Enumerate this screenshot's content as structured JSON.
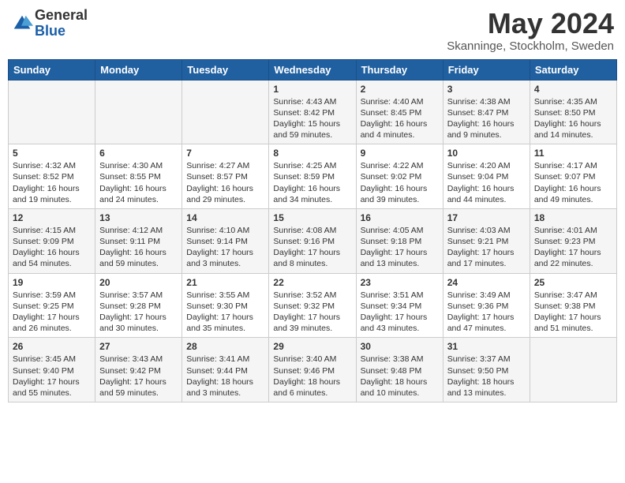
{
  "logo": {
    "general": "General",
    "blue": "Blue"
  },
  "title": "May 2024",
  "location": "Skanninge, Stockholm, Sweden",
  "weekdays": [
    "Sunday",
    "Monday",
    "Tuesday",
    "Wednesday",
    "Thursday",
    "Friday",
    "Saturday"
  ],
  "weeks": [
    [
      {
        "day": "",
        "info": ""
      },
      {
        "day": "",
        "info": ""
      },
      {
        "day": "",
        "info": ""
      },
      {
        "day": "1",
        "info": "Sunrise: 4:43 AM\nSunset: 8:42 PM\nDaylight: 15 hours\nand 59 minutes."
      },
      {
        "day": "2",
        "info": "Sunrise: 4:40 AM\nSunset: 8:45 PM\nDaylight: 16 hours\nand 4 minutes."
      },
      {
        "day": "3",
        "info": "Sunrise: 4:38 AM\nSunset: 8:47 PM\nDaylight: 16 hours\nand 9 minutes."
      },
      {
        "day": "4",
        "info": "Sunrise: 4:35 AM\nSunset: 8:50 PM\nDaylight: 16 hours\nand 14 minutes."
      }
    ],
    [
      {
        "day": "5",
        "info": "Sunrise: 4:32 AM\nSunset: 8:52 PM\nDaylight: 16 hours\nand 19 minutes."
      },
      {
        "day": "6",
        "info": "Sunrise: 4:30 AM\nSunset: 8:55 PM\nDaylight: 16 hours\nand 24 minutes."
      },
      {
        "day": "7",
        "info": "Sunrise: 4:27 AM\nSunset: 8:57 PM\nDaylight: 16 hours\nand 29 minutes."
      },
      {
        "day": "8",
        "info": "Sunrise: 4:25 AM\nSunset: 8:59 PM\nDaylight: 16 hours\nand 34 minutes."
      },
      {
        "day": "9",
        "info": "Sunrise: 4:22 AM\nSunset: 9:02 PM\nDaylight: 16 hours\nand 39 minutes."
      },
      {
        "day": "10",
        "info": "Sunrise: 4:20 AM\nSunset: 9:04 PM\nDaylight: 16 hours\nand 44 minutes."
      },
      {
        "day": "11",
        "info": "Sunrise: 4:17 AM\nSunset: 9:07 PM\nDaylight: 16 hours\nand 49 minutes."
      }
    ],
    [
      {
        "day": "12",
        "info": "Sunrise: 4:15 AM\nSunset: 9:09 PM\nDaylight: 16 hours\nand 54 minutes."
      },
      {
        "day": "13",
        "info": "Sunrise: 4:12 AM\nSunset: 9:11 PM\nDaylight: 16 hours\nand 59 minutes."
      },
      {
        "day": "14",
        "info": "Sunrise: 4:10 AM\nSunset: 9:14 PM\nDaylight: 17 hours\nand 3 minutes."
      },
      {
        "day": "15",
        "info": "Sunrise: 4:08 AM\nSunset: 9:16 PM\nDaylight: 17 hours\nand 8 minutes."
      },
      {
        "day": "16",
        "info": "Sunrise: 4:05 AM\nSunset: 9:18 PM\nDaylight: 17 hours\nand 13 minutes."
      },
      {
        "day": "17",
        "info": "Sunrise: 4:03 AM\nSunset: 9:21 PM\nDaylight: 17 hours\nand 17 minutes."
      },
      {
        "day": "18",
        "info": "Sunrise: 4:01 AM\nSunset: 9:23 PM\nDaylight: 17 hours\nand 22 minutes."
      }
    ],
    [
      {
        "day": "19",
        "info": "Sunrise: 3:59 AM\nSunset: 9:25 PM\nDaylight: 17 hours\nand 26 minutes."
      },
      {
        "day": "20",
        "info": "Sunrise: 3:57 AM\nSunset: 9:28 PM\nDaylight: 17 hours\nand 30 minutes."
      },
      {
        "day": "21",
        "info": "Sunrise: 3:55 AM\nSunset: 9:30 PM\nDaylight: 17 hours\nand 35 minutes."
      },
      {
        "day": "22",
        "info": "Sunrise: 3:52 AM\nSunset: 9:32 PM\nDaylight: 17 hours\nand 39 minutes."
      },
      {
        "day": "23",
        "info": "Sunrise: 3:51 AM\nSunset: 9:34 PM\nDaylight: 17 hours\nand 43 minutes."
      },
      {
        "day": "24",
        "info": "Sunrise: 3:49 AM\nSunset: 9:36 PM\nDaylight: 17 hours\nand 47 minutes."
      },
      {
        "day": "25",
        "info": "Sunrise: 3:47 AM\nSunset: 9:38 PM\nDaylight: 17 hours\nand 51 minutes."
      }
    ],
    [
      {
        "day": "26",
        "info": "Sunrise: 3:45 AM\nSunset: 9:40 PM\nDaylight: 17 hours\nand 55 minutes."
      },
      {
        "day": "27",
        "info": "Sunrise: 3:43 AM\nSunset: 9:42 PM\nDaylight: 17 hours\nand 59 minutes."
      },
      {
        "day": "28",
        "info": "Sunrise: 3:41 AM\nSunset: 9:44 PM\nDaylight: 18 hours\nand 3 minutes."
      },
      {
        "day": "29",
        "info": "Sunrise: 3:40 AM\nSunset: 9:46 PM\nDaylight: 18 hours\nand 6 minutes."
      },
      {
        "day": "30",
        "info": "Sunrise: 3:38 AM\nSunset: 9:48 PM\nDaylight: 18 hours\nand 10 minutes."
      },
      {
        "day": "31",
        "info": "Sunrise: 3:37 AM\nSunset: 9:50 PM\nDaylight: 18 hours\nand 13 minutes."
      },
      {
        "day": "",
        "info": ""
      }
    ]
  ]
}
